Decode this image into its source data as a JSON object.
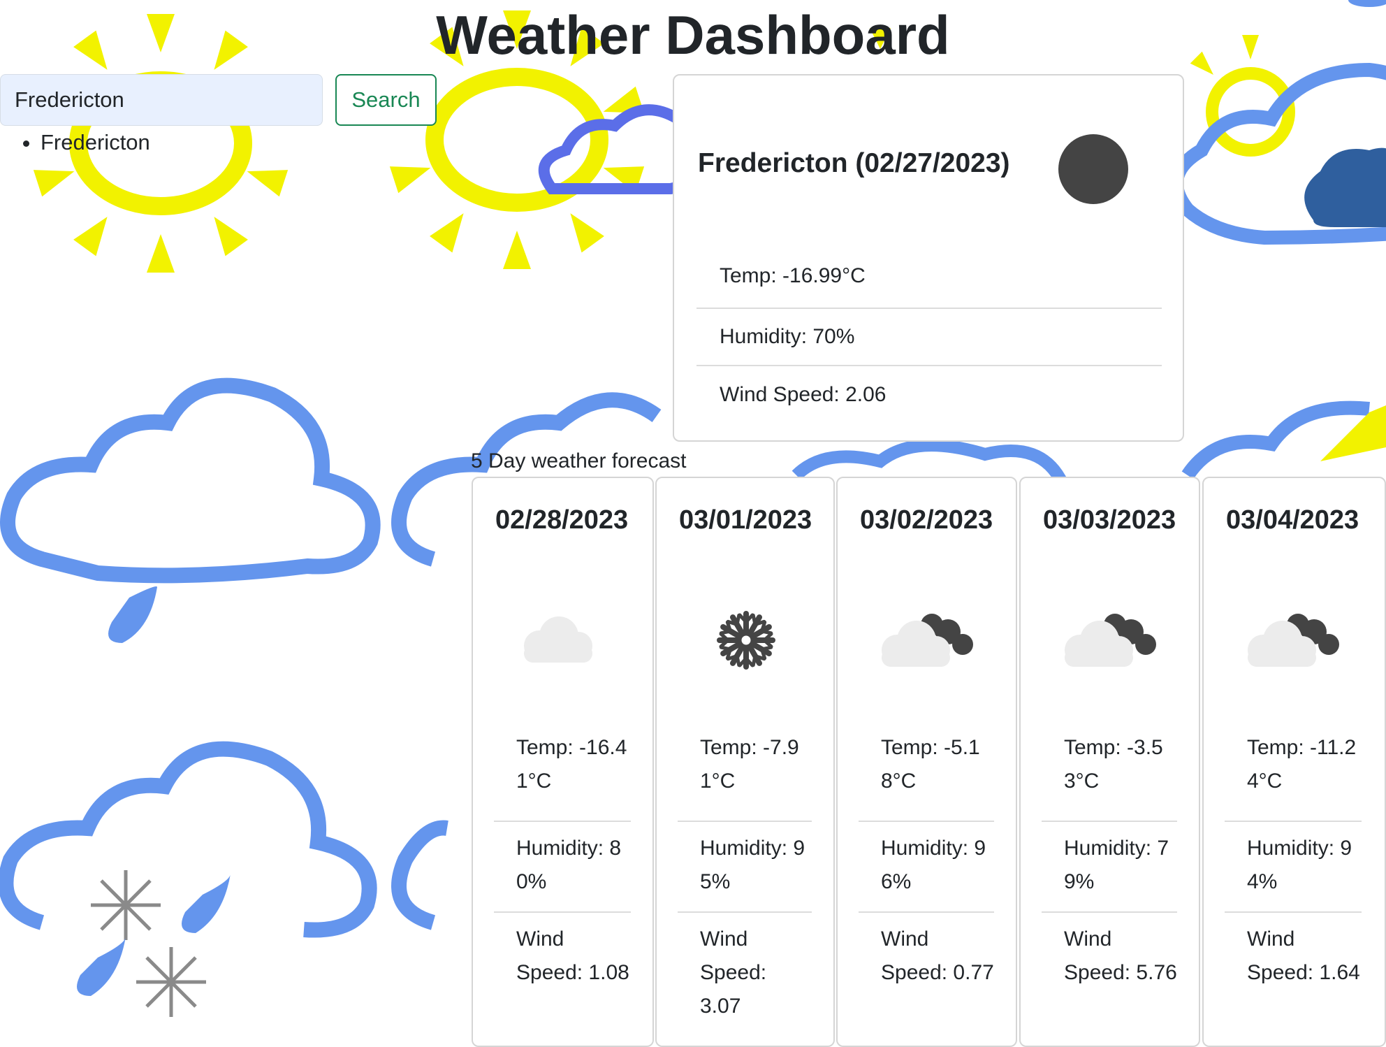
{
  "header": {
    "title": "Weather Dashboard"
  },
  "search": {
    "value": "Fredericton",
    "button_label": "Search"
  },
  "history": {
    "items": [
      "Fredericton"
    ]
  },
  "current": {
    "heading": "Fredericton (02/27/2023)",
    "icon": "dark-circle-icon",
    "temp": "Temp: -16.99°C",
    "humidity": "Humidity: 70%",
    "wind": "Wind Speed: 2.06"
  },
  "forecast": {
    "heading": "5 Day weather forecast",
    "days": [
      {
        "date": "02/28/2023",
        "icon": "cloud-icon",
        "temp": "Temp: -16.41°C",
        "humidity": "Humidity: 80%",
        "wind": "Wind Speed: 1.08"
      },
      {
        "date": "03/01/2023",
        "icon": "snowflake-icon",
        "temp": "Temp: -7.91°C",
        "humidity": "Humidity: 95%",
        "wind": "Wind Speed: 3.07"
      },
      {
        "date": "03/02/2023",
        "icon": "broken-clouds-icon",
        "temp": "Temp: -5.18°C",
        "humidity": "Humidity: 96%",
        "wind": "Wind Speed: 0.77"
      },
      {
        "date": "03/03/2023",
        "icon": "broken-clouds-icon",
        "temp": "Temp: -3.53°C",
        "humidity": "Humidity: 79%",
        "wind": "Wind Speed: 5.76"
      },
      {
        "date": "03/04/2023",
        "icon": "broken-clouds-icon",
        "temp": "Temp: -11.24°C",
        "humidity": "Humidity: 94%",
        "wind": "Wind Speed: 1.64"
      }
    ]
  },
  "colors": {
    "accent": "#198754",
    "input_bg": "#e8f0fe",
    "sun": "#f2f200",
    "cloud_outline": "#6495ed",
    "card_border": "#d5d5d5"
  }
}
